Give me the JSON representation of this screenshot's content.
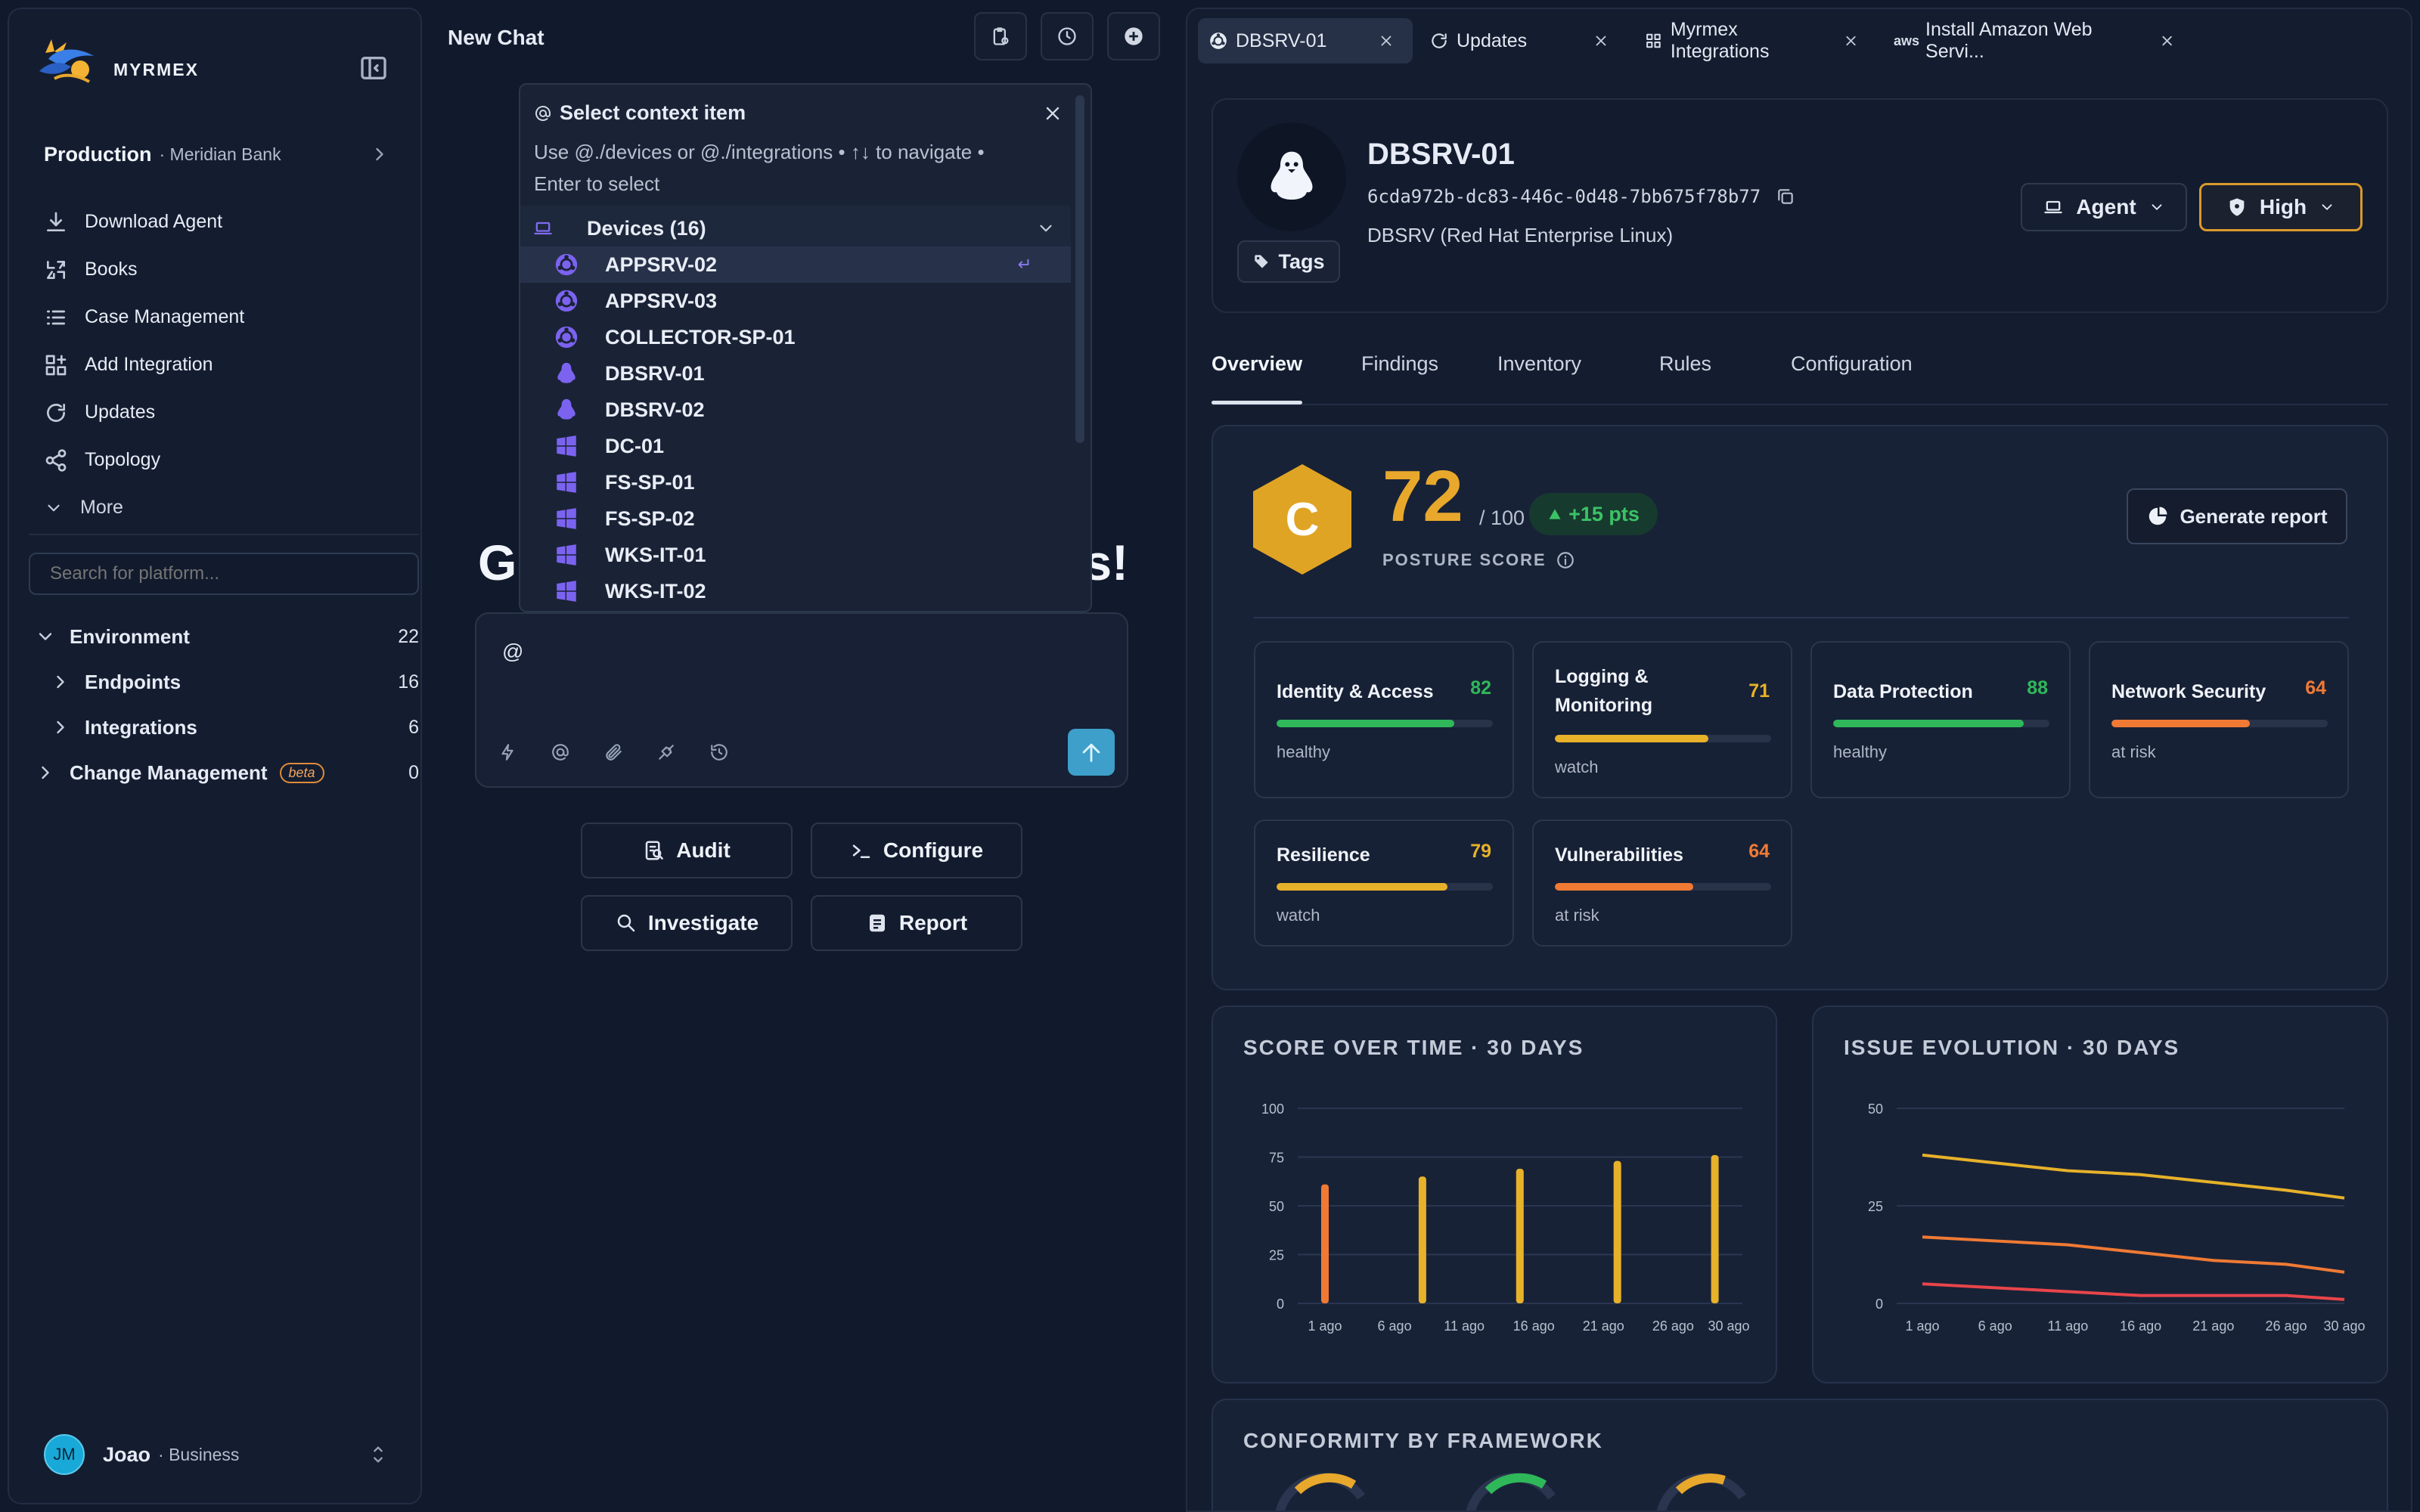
{
  "sidebar": {
    "logo_text": "MYRMEX",
    "org": {
      "name": "Production",
      "sub": "· Meridian Bank"
    },
    "nav": [
      {
        "label": "Download Agent",
        "icon": "download-icon"
      },
      {
        "label": "Books",
        "icon": "books-icon"
      },
      {
        "label": "Case Management",
        "icon": "list-icon"
      },
      {
        "label": "Add Integration",
        "icon": "add-integration-icon"
      },
      {
        "label": "Updates",
        "icon": "refresh-icon"
      },
      {
        "label": "Topology",
        "icon": "share-icon"
      },
      {
        "label": "More",
        "icon": "chevron-down-icon"
      }
    ],
    "search_placeholder": "Search for platform...",
    "tree": {
      "environment": {
        "label": "Environment",
        "count": "22"
      },
      "endpoints": {
        "label": "Endpoints",
        "count": "16"
      },
      "integrations": {
        "label": "Integrations",
        "count": "6"
      },
      "change": {
        "label": "Change Management",
        "badge": "beta",
        "count": "0"
      }
    },
    "user": {
      "initials": "JM",
      "name": "Joao",
      "plan": "· Business"
    }
  },
  "chat": {
    "title": "New Chat",
    "hero_left": "G",
    "hero_right": "s!",
    "composer_value": "@",
    "actions": {
      "audit": "Audit",
      "configure": "Configure",
      "investigate": "Investigate",
      "report": "Report"
    },
    "context": {
      "title": "Select context item",
      "hint": "Use @./devices or @./integrations • ↑↓ to navigate • Enter to select",
      "group": "Devices (16)",
      "items": [
        {
          "label": "APPSRV-02",
          "os": "ubuntu"
        },
        {
          "label": "APPSRV-03",
          "os": "ubuntu"
        },
        {
          "label": "COLLECTOR-SP-01",
          "os": "ubuntu"
        },
        {
          "label": "DBSRV-01",
          "os": "linux"
        },
        {
          "label": "DBSRV-02",
          "os": "linux"
        },
        {
          "label": "DC-01",
          "os": "windows"
        },
        {
          "label": "FS-SP-01",
          "os": "windows"
        },
        {
          "label": "FS-SP-02",
          "os": "windows"
        },
        {
          "label": "WKS-IT-01",
          "os": "windows"
        },
        {
          "label": "WKS-IT-02",
          "os": "windows"
        }
      ]
    }
  },
  "tabs": [
    {
      "label": "DBSRV-01",
      "icon": "ubuntu-icon",
      "active": true
    },
    {
      "label": "Updates",
      "icon": "refresh-icon"
    },
    {
      "label": "Myrmex Integrations",
      "icon": "grid-icon"
    },
    {
      "label": "Install Amazon Web Servi...",
      "icon": "aws-icon",
      "icon_text": "aws"
    }
  ],
  "device": {
    "name": "DBSRV-01",
    "id": "6cda972b-dc83-446c-0d48-7bb675f78b77",
    "os": "DBSRV (Red Hat Enterprise Linux)",
    "tags_label": "Tags",
    "agent_label": "Agent",
    "risk_label": "High"
  },
  "panel_tabs": [
    "Overview",
    "Findings",
    "Inventory",
    "Rules",
    "Configuration"
  ],
  "posture": {
    "grade": "C",
    "score": "72",
    "of": "/ 100",
    "delta": "+15 pts",
    "label": "POSTURE SCORE",
    "generate_label": "Generate report",
    "categories": [
      {
        "title": "Identity & Access",
        "value": "82",
        "score": 82,
        "status": "healthy",
        "color": "#2fb85a"
      },
      {
        "title": "Logging & Monitoring",
        "value": "71",
        "score": 71,
        "status": "watch",
        "color": "#e7b22a"
      },
      {
        "title": "Data Protection",
        "value": "88",
        "score": 88,
        "status": "healthy",
        "color": "#2fb85a"
      },
      {
        "title": "Network Security",
        "value": "64",
        "score": 64,
        "status": "at risk",
        "color": "#f07a34"
      },
      {
        "title": "Resilience",
        "value": "79",
        "score": 79,
        "status": "watch",
        "color": "#e7b22a"
      },
      {
        "title": "Vulnerabilities",
        "value": "64",
        "score": 64,
        "status": "at risk",
        "color": "#f07a34"
      }
    ]
  },
  "chart_data": [
    {
      "type": "bar",
      "title": "SCORE OVER TIME · 30 DAYS",
      "categories": [
        "1 ago",
        "6 ago",
        "11 ago",
        "16 ago",
        "21 ago",
        "26 ago",
        "30 ago"
      ],
      "bars": [
        {
          "x": 1,
          "value": 61,
          "color": "#f07a34"
        },
        {
          "x": 8,
          "value": 65,
          "color": "#e7b22a"
        },
        {
          "x": 15,
          "value": 69,
          "color": "#e7b22a"
        },
        {
          "x": 22,
          "value": 73,
          "color": "#e7b22a"
        },
        {
          "x": 29,
          "value": 76,
          "color": "#e7b22a"
        }
      ],
      "xticks": [
        1,
        6,
        11,
        16,
        21,
        26,
        30
      ],
      "ylim": [
        0,
        100
      ],
      "yticks": [
        0,
        25,
        50,
        75,
        100
      ]
    },
    {
      "type": "line",
      "title": "ISSUE EVOLUTION · 30 DAYS",
      "x": [
        1,
        6,
        11,
        16,
        21,
        26,
        30
      ],
      "xlabels": [
        "1 ago",
        "6 ago",
        "11 ago",
        "16 ago",
        "21 ago",
        "26 ago",
        "30 ago"
      ],
      "series": [
        {
          "values": [
            38,
            36,
            34,
            33,
            31,
            29,
            27
          ],
          "color": "#e7b22a"
        },
        {
          "values": [
            17,
            16,
            15,
            13,
            11,
            10,
            8
          ],
          "color": "#f07a34"
        },
        {
          "values": [
            5,
            4,
            3,
            2,
            2,
            2,
            1
          ],
          "color": "#e8454a"
        }
      ],
      "ylim": [
        0,
        50
      ],
      "yticks": [
        0,
        25,
        50
      ]
    }
  ],
  "conformity": {
    "title": "CONFORMITY BY FRAMEWORK"
  }
}
